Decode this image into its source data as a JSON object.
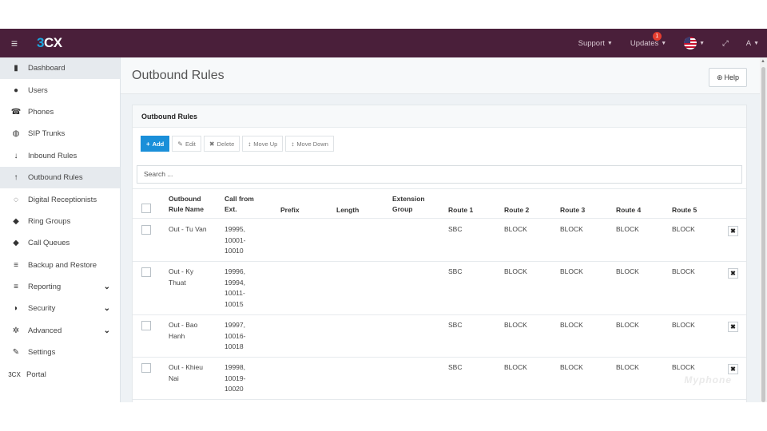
{
  "topbar": {
    "logo_3": "3",
    "logo_cx": "CX",
    "support": "Support",
    "updates": "Updates",
    "updates_badge": "1",
    "user": "A"
  },
  "sidebar": {
    "items": [
      {
        "label": "Dashboard",
        "icon": "bar-chart-icon",
        "glyph": "▮"
      },
      {
        "label": "Users",
        "icon": "user-icon",
        "glyph": "●"
      },
      {
        "label": "Phones",
        "icon": "phone-icon",
        "glyph": "☎"
      },
      {
        "label": "SIP Trunks",
        "icon": "globe-icon",
        "glyph": "◍"
      },
      {
        "label": "Inbound Rules",
        "icon": "arrow-down-icon",
        "glyph": "↓"
      },
      {
        "label": "Outbound Rules",
        "icon": "arrow-up-icon",
        "glyph": "↑"
      },
      {
        "label": "Digital Receptionists",
        "icon": "headset-icon",
        "glyph": "◌"
      },
      {
        "label": "Ring Groups",
        "icon": "group-icon",
        "glyph": "◆"
      },
      {
        "label": "Call Queues",
        "icon": "queue-icon",
        "glyph": "◆"
      },
      {
        "label": "Backup and Restore",
        "icon": "database-icon",
        "glyph": "≡"
      },
      {
        "label": "Reporting",
        "icon": "list-icon",
        "glyph": "≡"
      },
      {
        "label": "Security",
        "icon": "shield-icon",
        "glyph": "◗"
      },
      {
        "label": "Advanced",
        "icon": "gear-icon",
        "glyph": "✲"
      },
      {
        "label": "Settings",
        "icon": "wrench-icon",
        "glyph": "✎"
      },
      {
        "label": "Portal",
        "icon": "3cx-logo-icon",
        "glyph": "3CX"
      }
    ]
  },
  "page": {
    "title": "Outbound Rules",
    "help": "Help"
  },
  "panel": {
    "title": "Outbound Rules",
    "toolbar": {
      "add": "Add",
      "edit": "Edit",
      "delete": "Delete",
      "move_up": "Move Up",
      "move_down": "Move Down"
    },
    "search_placeholder": "Search ..."
  },
  "table": {
    "headers": {
      "rule_name_1": "Outbound",
      "rule_name_2": "Rule Name",
      "call_from_1": "Call from",
      "call_from_2": "Ext.",
      "prefix": "Prefix",
      "length": "Length",
      "ext_group_1": "Extension",
      "ext_group_2": "Group",
      "route1": "Route 1",
      "route2": "Route 2",
      "route3": "Route 3",
      "route4": "Route 4",
      "route5": "Route 5"
    },
    "rows": [
      {
        "name_1": "Out - Tu Van",
        "name_2": "",
        "ext_1": "19995,",
        "ext_2": "10001-",
        "ext_3": "10010",
        "ext_4": "",
        "route1": "SBC",
        "route2": "BLOCK",
        "route3": "BLOCK",
        "route4": "BLOCK",
        "route5": "BLOCK"
      },
      {
        "name_1": "Out - Ky",
        "name_2": "Thuat",
        "ext_1": "19996,",
        "ext_2": "19994,",
        "ext_3": "10011-",
        "ext_4": "10015",
        "route1": "SBC",
        "route2": "BLOCK",
        "route3": "BLOCK",
        "route4": "BLOCK",
        "route5": "BLOCK"
      },
      {
        "name_1": "Out - Bao",
        "name_2": "Hanh",
        "ext_1": "19997,",
        "ext_2": "10016-",
        "ext_3": "10018",
        "ext_4": "",
        "route1": "SBC",
        "route2": "BLOCK",
        "route3": "BLOCK",
        "route4": "BLOCK",
        "route5": "BLOCK"
      },
      {
        "name_1": "Out - Khieu",
        "name_2": "Nai",
        "ext_1": "19998,",
        "ext_2": "10019-",
        "ext_3": "10020",
        "ext_4": "",
        "route1": "SBC",
        "route2": "BLOCK",
        "route3": "BLOCK",
        "route4": "BLOCK",
        "route5": "BLOCK"
      }
    ]
  },
  "watermark": "Myphone",
  "colors": {
    "topbar": "#4a1f3a",
    "accent": "#1a8fd9",
    "badge": "#e43d30"
  }
}
